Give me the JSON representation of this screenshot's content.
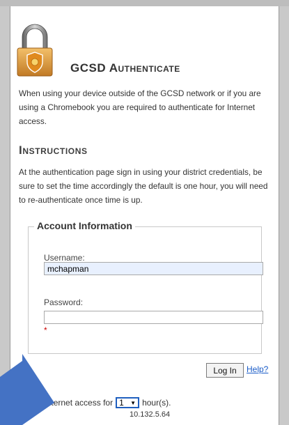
{
  "app": {
    "title": "GCSD Authenticate",
    "intro": "When using your device outside of the GCSD network or if you are using a Chromebook you are required to authenticate for Internet access."
  },
  "instructions": {
    "heading": "Instructions",
    "text": "At the authentication page sign in using your district credentials, be sure to set the time accordingly the default is one hour, you will need to re-authenticate once time is up."
  },
  "account": {
    "legend": "Account Information",
    "username_label": "Username:",
    "username_value": "mchapman",
    "password_label": "Password:",
    "password_value": "",
    "required_mark": "*"
  },
  "actions": {
    "login_label": "Log In",
    "help_label": "Help?"
  },
  "access": {
    "prefix": "eed Internet access for",
    "hours_value": "1",
    "suffix": "hour(s).",
    "ip": "10.132.5.64"
  },
  "colors": {
    "arrow": "#4472c4",
    "link": "#1a5cc8",
    "required": "#cc0000",
    "autofill": "#e8f0fe"
  },
  "icons": {
    "lock": "padlock-shield-icon",
    "select_caret": "caret-down-icon",
    "arrow": "pointer-arrow-overlay"
  }
}
